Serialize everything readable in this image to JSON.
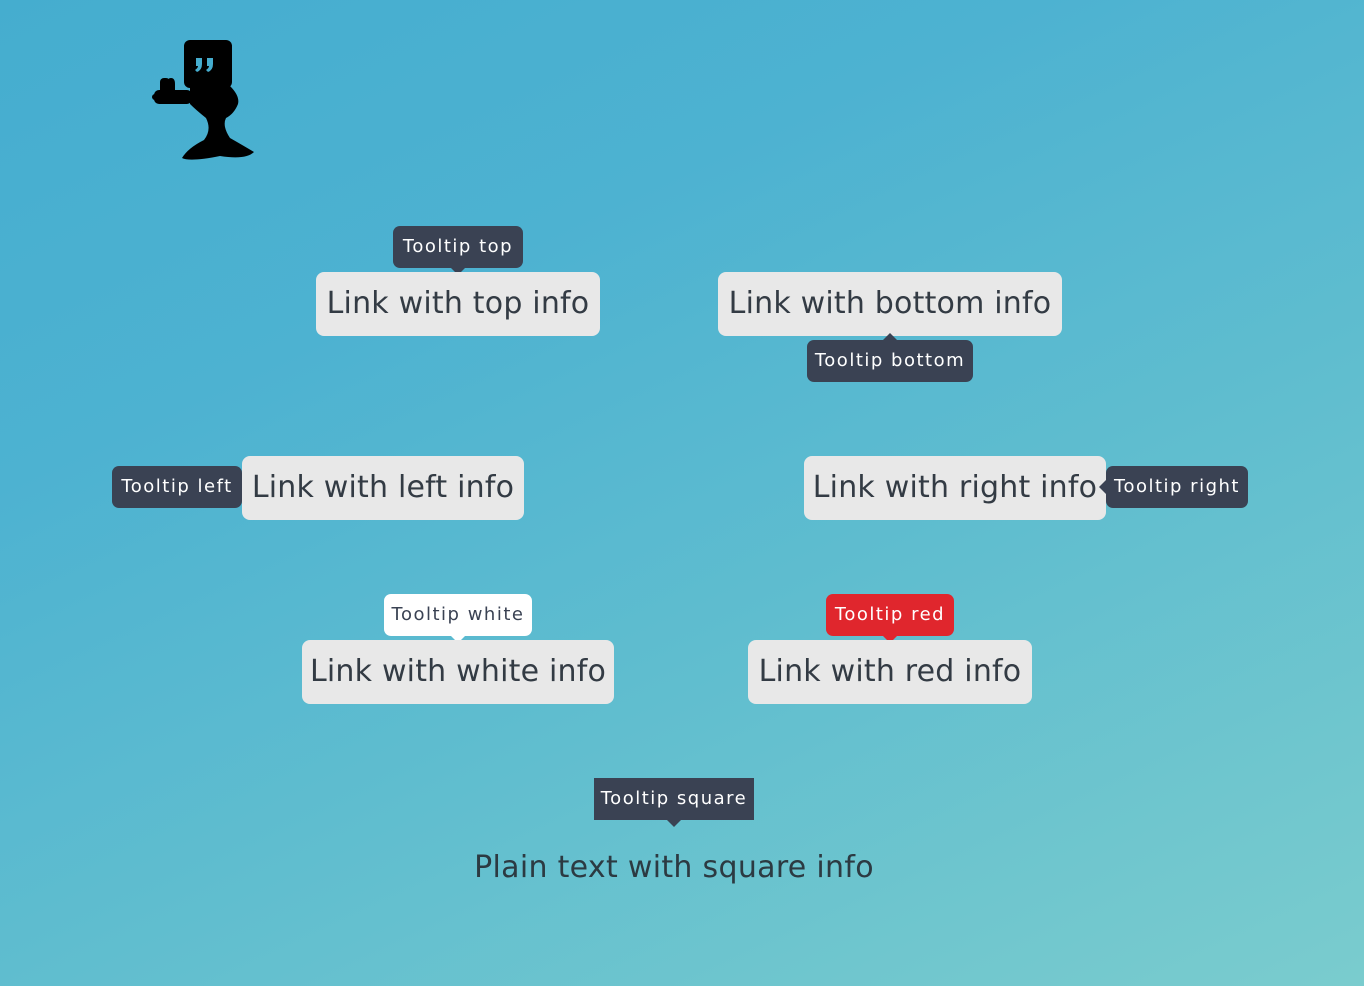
{
  "logo": {
    "icon": "quote-mascot-icon",
    "color": "#000000"
  },
  "links": {
    "top": "Link with top info",
    "bottom": "Link with bottom info",
    "left": "Link with left info",
    "right": "Link with right info",
    "white": "Link with white info",
    "red": "Link with red info"
  },
  "tooltips": {
    "top": "Tooltip top",
    "bottom": "Tooltip bottom",
    "left": "Tooltip left",
    "right": "Tooltip right",
    "white": "Tooltip white",
    "red": "Tooltip red",
    "square": "Tooltip square"
  },
  "plain_text": "Plain text with square info",
  "colors": {
    "tooltip_dark": "#3a4253",
    "tooltip_white": "#ffffff",
    "tooltip_red": "#e0262d",
    "link_bg": "#e8e8e8",
    "background_start": "#45adcf",
    "background_end": "#7accce"
  }
}
